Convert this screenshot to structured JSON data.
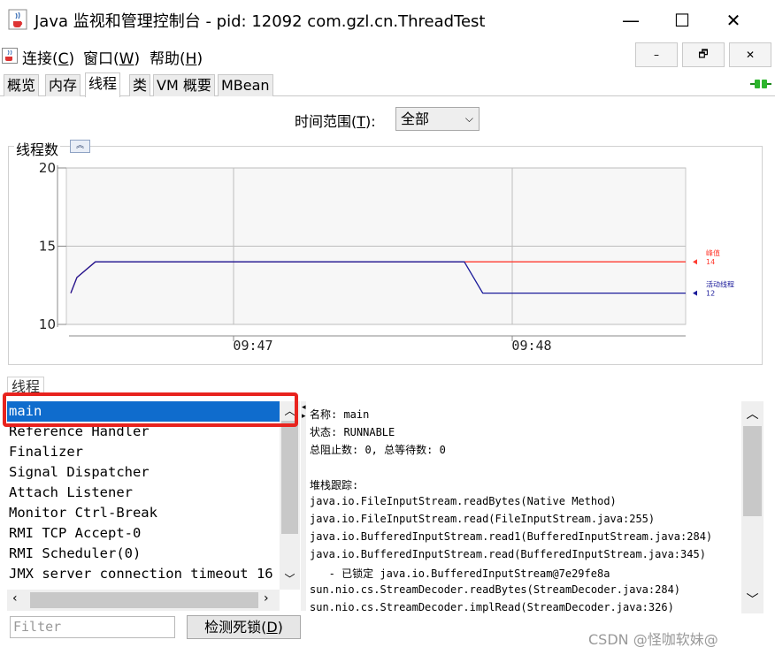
{
  "window": {
    "title": "Java 监视和管理控制台 - pid: 12092 com.gzl.cn.ThreadTest",
    "minimize": "—",
    "maximize": "☐",
    "close": "✕"
  },
  "menu": {
    "items": [
      {
        "label": "连接(",
        "key": "C",
        "suffix": ")"
      },
      {
        "label": "窗口(",
        "key": "W",
        "suffix": ")"
      },
      {
        "label": "帮助(",
        "key": "H",
        "suffix": ")"
      }
    ],
    "mdi_min": "–",
    "mdi_restore": "🗗",
    "mdi_close": "✕"
  },
  "tabs": [
    "概览",
    "内存",
    "线程",
    "类",
    "VM 概要",
    "MBean"
  ],
  "active_tab": "线程",
  "time_range": {
    "label": "时间范围(",
    "key": "T",
    "suffix": "):",
    "selected": "全部"
  },
  "chart_data": {
    "type": "line",
    "title": "线程数",
    "y_ticks": [
      "20",
      "15",
      "10"
    ],
    "ylim": [
      10,
      20
    ],
    "x_ticks": [
      "09:47",
      "09:48"
    ],
    "grid": true,
    "legend_position": "right",
    "series": [
      {
        "name": "峰值",
        "color": "#ff3b30",
        "current": "14",
        "points": [
          [
            0.0,
            12
          ],
          [
            0.01,
            13
          ],
          [
            0.04,
            14
          ],
          [
            1.0,
            14
          ]
        ]
      },
      {
        "name": "活动线程",
        "color": "#1a1a9a",
        "current": "12",
        "points": [
          [
            0.0,
            12
          ],
          [
            0.01,
            13
          ],
          [
            0.04,
            14
          ],
          [
            0.64,
            14
          ],
          [
            0.67,
            12
          ],
          [
            1.0,
            12
          ]
        ]
      }
    ]
  },
  "threads": {
    "title": "线程",
    "items": [
      "main",
      "Reference Handler",
      "Finalizer",
      "Signal Dispatcher",
      "Attach Listener",
      "Monitor Ctrl-Break",
      "RMI TCP Accept-0",
      "RMI Scheduler(0)",
      "JMX server connection timeout 16"
    ],
    "selected": "main",
    "filter_placeholder": "Filter",
    "deadlock_button": {
      "label": "检测死锁(",
      "key": "D",
      "suffix": ")"
    }
  },
  "details": {
    "lines": [
      "名称: main",
      "状态: RUNNABLE",
      "总阻止数: 0, 总等待数: 0",
      "",
      "堆栈跟踪:",
      "java.io.FileInputStream.readBytes(Native Method)",
      "java.io.FileInputStream.read(FileInputStream.java:255)",
      "java.io.BufferedInputStream.read1(BufferedInputStream.java:284)",
      "java.io.BufferedInputStream.read(BufferedInputStream.java:345)",
      "   - 已锁定 java.io.BufferedInputStream@7e29fe8a",
      "sun.nio.cs.StreamDecoder.readBytes(StreamDecoder.java:284)",
      "sun.nio.cs.StreamDecoder.implRead(StreamDecoder.java:326)"
    ]
  },
  "watermark": "CSDN @怪咖软妹@",
  "colors": {
    "selection": "#0f6ccd",
    "highlight_box": "#e8231e",
    "peak": "#ff3b30",
    "live": "#1a1a9a"
  }
}
